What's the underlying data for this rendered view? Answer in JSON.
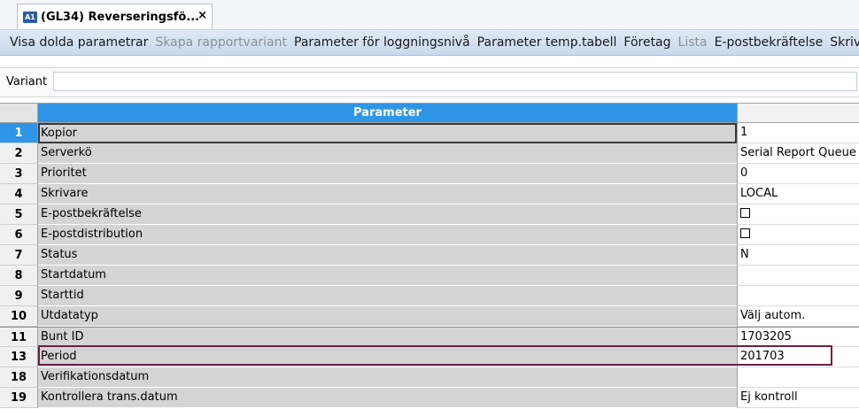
{
  "tab": {
    "icon_text": "A1",
    "title": "(GL34) Reverseringsfö...",
    "close_glyph": "×"
  },
  "toolbar": {
    "items": [
      {
        "label": "Visa dolda parametrar",
        "enabled": true
      },
      {
        "label": "Skapa rapportvariant",
        "enabled": false
      },
      {
        "label": "Parameter för loggningsnivå",
        "enabled": true
      },
      {
        "label": "Parameter temp.tabell",
        "enabled": true
      },
      {
        "label": "Företag",
        "enabled": true
      },
      {
        "label": "Lista",
        "enabled": false
      },
      {
        "label": "E-postbekräftelse",
        "enabled": true
      },
      {
        "label": "Skrivarparam",
        "enabled": true
      }
    ]
  },
  "variant": {
    "label": "Variant",
    "value": ""
  },
  "grid": {
    "header_param": "Parameter",
    "rows": [
      {
        "num": "1",
        "param": "Kopior",
        "value": "1",
        "active": true
      },
      {
        "num": "2",
        "param": "Serverkö",
        "value": "Serial Report Queue"
      },
      {
        "num": "3",
        "param": "Prioritet",
        "value": "0"
      },
      {
        "num": "4",
        "param": "Skrivare",
        "value": "LOCAL"
      },
      {
        "num": "5",
        "param": "E-postbekräftelse",
        "value": "",
        "checkbox": true
      },
      {
        "num": "6",
        "param": "E-postdistribution",
        "value": "",
        "checkbox": true
      },
      {
        "num": "7",
        "param": "Status",
        "value": "N"
      },
      {
        "num": "8",
        "param": "Startdatum",
        "value": ""
      },
      {
        "num": "9",
        "param": "Starttid",
        "value": ""
      },
      {
        "num": "10",
        "param": "Utdatatyp",
        "value": "Välj autom."
      },
      {
        "num": "11",
        "param": "Bunt ID",
        "value": "1703205"
      },
      {
        "num": "13",
        "param": "Period",
        "value": "201703",
        "focused": true
      },
      {
        "num": "18",
        "param": "Verifikationsdatum",
        "value": ""
      },
      {
        "num": "19",
        "param": "Kontrollera trans.datum",
        "value": "Ej kontroll"
      }
    ]
  }
}
